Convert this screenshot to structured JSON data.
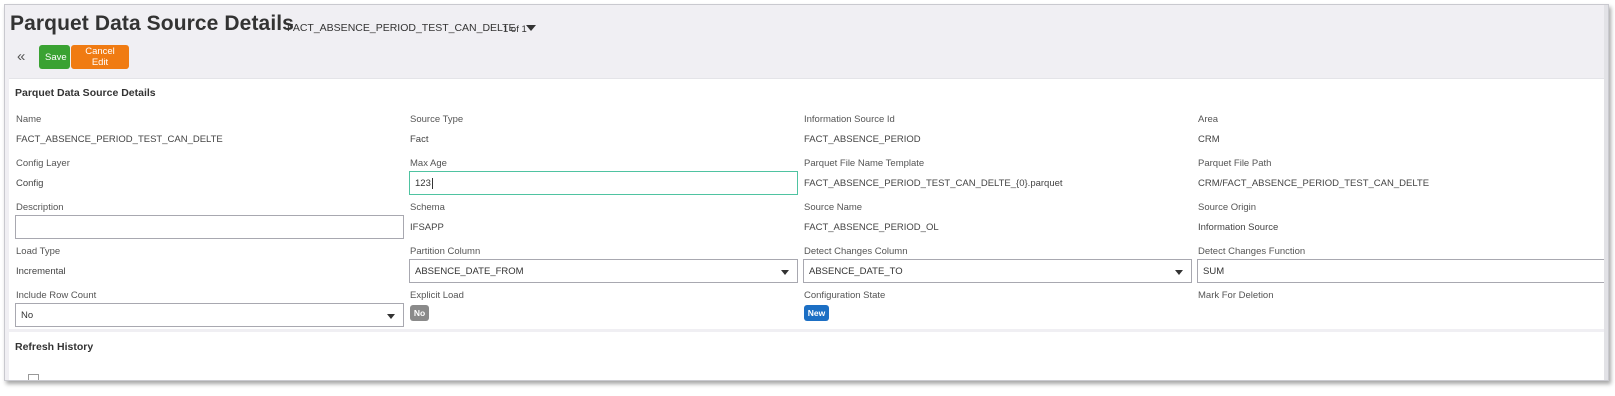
{
  "header": {
    "title": "Parquet Data Source Details",
    "record_selector": "FACT_ABSENCE_PERIOD_TEST_CAN_DELTE",
    "record_count": "1 of 1"
  },
  "toolbar": {
    "save_label": "Save",
    "cancel_label": "Cancel Edit"
  },
  "details": {
    "title": "Parquet Data Source Details",
    "name": {
      "label": "Name",
      "value": "FACT_ABSENCE_PERIOD_TEST_CAN_DELTE"
    },
    "source_type": {
      "label": "Source Type",
      "value": "Fact"
    },
    "information_source_id": {
      "label": "Information Source Id",
      "value": "FACT_ABSENCE_PERIOD"
    },
    "area": {
      "label": "Area",
      "value": "CRM"
    },
    "config_layer": {
      "label": "Config Layer",
      "value": "Config"
    },
    "max_age": {
      "label": "Max Age",
      "value": "123"
    },
    "parquet_file_name_template": {
      "label": "Parquet File Name Template",
      "value": "FACT_ABSENCE_PERIOD_TEST_CAN_DELTE_{0}.parquet"
    },
    "parquet_file_path": {
      "label": "Parquet File Path",
      "value": "CRM/FACT_ABSENCE_PERIOD_TEST_CAN_DELTE"
    },
    "description": {
      "label": "Description",
      "value": ""
    },
    "schema": {
      "label": "Schema",
      "value": "IFSAPP"
    },
    "source_name": {
      "label": "Source Name",
      "value": "FACT_ABSENCE_PERIOD_OL"
    },
    "source_origin": {
      "label": "Source Origin",
      "value": "Information Source"
    },
    "load_type": {
      "label": "Load Type",
      "value": "Incremental"
    },
    "partition_column": {
      "label": "Partition Column",
      "value": "ABSENCE_DATE_FROM"
    },
    "detect_changes_column": {
      "label": "Detect Changes Column",
      "value": "ABSENCE_DATE_TO"
    },
    "detect_changes_function": {
      "label": "Detect Changes Function",
      "value": "SUM"
    },
    "include_row_count": {
      "label": "Include Row Count",
      "value": "No"
    },
    "explicit_load": {
      "label": "Explicit Load",
      "value": "No"
    },
    "configuration_state": {
      "label": "Configuration State",
      "value": "New"
    },
    "mark_for_deletion": {
      "label": "Mark For Deletion",
      "value": ""
    }
  },
  "history": {
    "title": "Refresh History"
  },
  "colors": {
    "save": "#3aa232",
    "cancel": "#f07b12",
    "badge_no": "#8a8a8a",
    "badge_new": "#1c6fc4",
    "focus": "#4fc3a1"
  },
  "icons": {
    "collapse": "double-chevron-left-icon",
    "dropdown": "caret-down-icon"
  }
}
